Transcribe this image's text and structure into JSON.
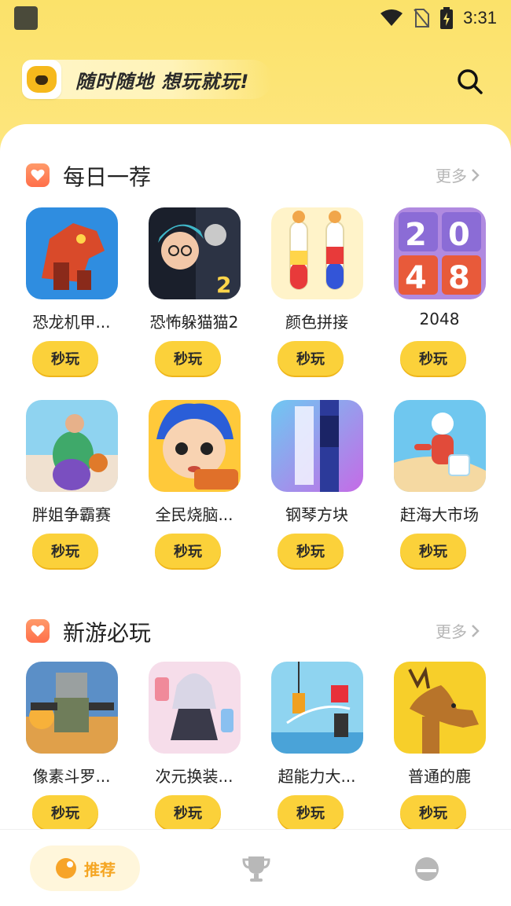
{
  "status": {
    "time": "3:31"
  },
  "header": {
    "slogan": "随时随地 想玩就玩!"
  },
  "sections": [
    {
      "title": "每日一荐",
      "more": "更多",
      "games": [
        {
          "name": "恐龙机甲...",
          "play": "秒玩",
          "icon": "dino-mech-icon"
        },
        {
          "name": "恐怖躲猫猫2",
          "play": "秒玩",
          "icon": "horror-hide-seek-icon"
        },
        {
          "name": "颜色拼接",
          "play": "秒玩",
          "icon": "color-sort-icon"
        },
        {
          "name": "2048",
          "play": "秒玩",
          "icon": "game-2048-icon"
        },
        {
          "name": "胖姐争霸赛",
          "play": "秒玩",
          "icon": "fat-race-icon"
        },
        {
          "name": "全民烧脑...",
          "play": "秒玩",
          "icon": "brain-burn-icon"
        },
        {
          "name": "钢琴方块",
          "play": "秒玩",
          "icon": "piano-tiles-icon"
        },
        {
          "name": "赶海大市场",
          "play": "秒玩",
          "icon": "beach-market-icon"
        }
      ]
    },
    {
      "title": "新游必玩",
      "more": "更多",
      "games": [
        {
          "name": "像素斗罗...",
          "play": "秒玩",
          "icon": "pixel-soldier-icon"
        },
        {
          "name": "次元换装...",
          "play": "秒玩",
          "icon": "dressup-icon"
        },
        {
          "name": "超能力大...",
          "play": "秒玩",
          "icon": "superpower-icon"
        },
        {
          "name": "普通的鹿",
          "play": "秒玩",
          "icon": "deer-icon"
        }
      ]
    }
  ],
  "nav": {
    "home": "推荐"
  },
  "colors": {
    "accent": "#fbd13a",
    "bg": "#fbe36e",
    "nav_active": "#f5a623"
  }
}
